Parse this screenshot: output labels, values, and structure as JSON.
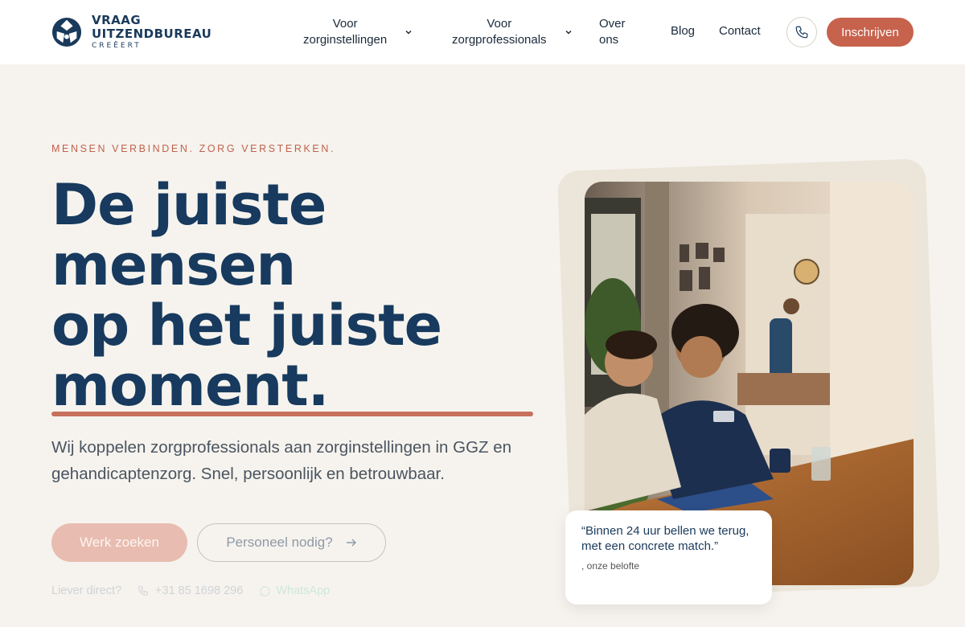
{
  "logo": {
    "line1": "VRAAG",
    "line2": "UITZENDBUREAU",
    "line3": "CREËERT",
    "brand_color": "#1a3a5c"
  },
  "nav": {
    "items": [
      {
        "label_line1": "Voor",
        "label_line2": "zorginstellingen",
        "has_dropdown": true
      },
      {
        "label_line1": "Voor",
        "label_line2": "zorgprofessionals",
        "has_dropdown": true
      },
      {
        "label_line1": "Over",
        "label_line2": "ons",
        "has_dropdown": false
      },
      {
        "label": "Blog",
        "has_dropdown": false
      },
      {
        "label": "Contact",
        "has_dropdown": false
      }
    ],
    "phone_icon": "phone-icon",
    "cta_label": "Inschrijven",
    "cta_color": "#c7624c"
  },
  "hero": {
    "eyebrow": "MENSEN VERBINDEN. ZORG VERSTERKEN.",
    "headline_lines": [
      "De juiste",
      "mensen",
      "op het juiste",
      "moment."
    ],
    "lead": "Wij koppelen zorgprofessionals aan zorginstellingen in GGZ en gehandicaptenzorg. Snel, persoonlijk en betrouwbaar.",
    "primary_button": "Werk zoeken",
    "secondary_button": "Personeel nodig?",
    "secondary_icon": "arrow-right-icon",
    "direct_label": "Liever direct?",
    "direct_phone": "+31 85 1698 296",
    "direct_whatsapp": "WhatsApp",
    "accent_color": "#c0624d",
    "headline_color": "#173a5e"
  },
  "photo": {
    "subject": "care-worker-and-client-doing-puzzle",
    "shirt_logo": "VRAAG"
  },
  "quote": {
    "text": "“Binnen 24 uur bellen we terug, met een concrete match.”",
    "attribution": ", onze belofte"
  }
}
